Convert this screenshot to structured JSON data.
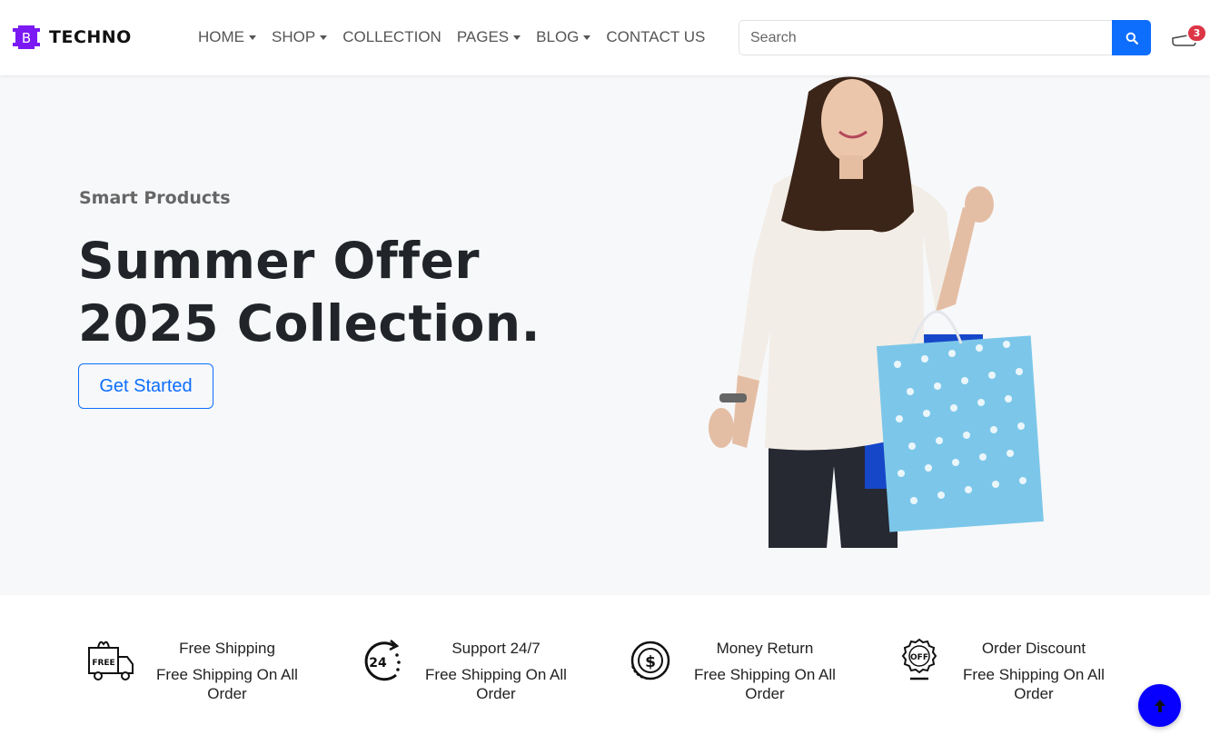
{
  "brand": {
    "logo_letter": "B",
    "name": "TECHNO",
    "logo_color": "#7a19f3"
  },
  "nav": [
    {
      "label": "HOME",
      "dropdown": true
    },
    {
      "label": "SHOP",
      "dropdown": true
    },
    {
      "label": "COLLECTION",
      "dropdown": false
    },
    {
      "label": "PAGES",
      "dropdown": true
    },
    {
      "label": "BLOG",
      "dropdown": true
    },
    {
      "label": "CONTACT US",
      "dropdown": false
    }
  ],
  "search": {
    "placeholder": "Search",
    "icon": "search-icon"
  },
  "cart": {
    "icon": "cart-icon",
    "count": "3"
  },
  "hero": {
    "eyebrow": "Smart Products",
    "title_line1": "Summer Offer",
    "title_line2": "2025 Collection.",
    "cta": "Get Started"
  },
  "features": [
    {
      "icon": "free-delivery-truck-icon",
      "icon_text": "FREE",
      "title": "Free Shipping",
      "desc": "Free Shipping On All Order"
    },
    {
      "icon": "support-24-icon",
      "icon_text": "24",
      "title": "Support 24/7",
      "desc": "Free Shipping On All Order"
    },
    {
      "icon": "money-return-icon",
      "icon_text": "$",
      "title": "Money Return",
      "desc": "Free Shipping On All Order"
    },
    {
      "icon": "discount-badge-icon",
      "icon_text": "OFF",
      "title": "Order Discount",
      "desc": "Free Shipping On All Order"
    }
  ],
  "colors": {
    "primary": "#0d6efd",
    "badge": "#dc3545",
    "scroll_top": "#0800ff",
    "hero_bg": "#f7f8fa"
  }
}
